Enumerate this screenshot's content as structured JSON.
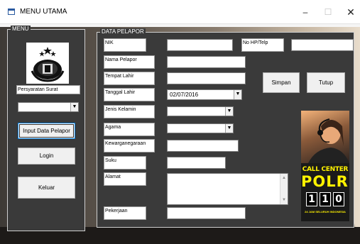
{
  "window": {
    "title": "MENU UTAMA",
    "minimize_glyph": "–",
    "maximize_glyph": "☐",
    "close_glyph": "✕"
  },
  "menu": {
    "legend": "MENU",
    "persyaratan_label": "Persyaratan Surat",
    "persyaratan_value": "",
    "input_button": "Input Data Pelapor",
    "login_button": "Login",
    "keluar_button": "Keluar"
  },
  "form": {
    "legend": "DATA PELAPOR",
    "labels": {
      "nik": "NIK",
      "nama": "Nama Pelapor",
      "tempat_lahir": "Tempat Lahir",
      "tanggal_lahir": "Tanggal Lahir",
      "jenis_kelamin": "Jenis Kelamin",
      "agama": "Agama",
      "kewarganegaraan": "Kewarganegaraan",
      "suku": "Suku",
      "alamat": "Alamat",
      "pekerjaan": "Pekerjaan",
      "no_hp": "No HP/Telp"
    },
    "values": {
      "nik": "",
      "nama": "",
      "tempat_lahir": "",
      "tanggal_lahir": "02/07/2016",
      "jenis_kelamin": "",
      "agama": "",
      "kewarganegaraan": "",
      "suku": "",
      "alamat": "",
      "pekerjaan": "",
      "no_hp": ""
    },
    "simpan_button": "Simpan",
    "tutup_button": "Tutup"
  },
  "banner": {
    "line1": "CALL CENTER",
    "line2": "POLRI",
    "digits": [
      "1",
      "1",
      "0"
    ],
    "line3": "24 JAM SELURUH INDONESIA"
  },
  "colors": {
    "panel": "#3a3a3a",
    "banner_text": "#fff200",
    "focus": "#0078d7"
  }
}
